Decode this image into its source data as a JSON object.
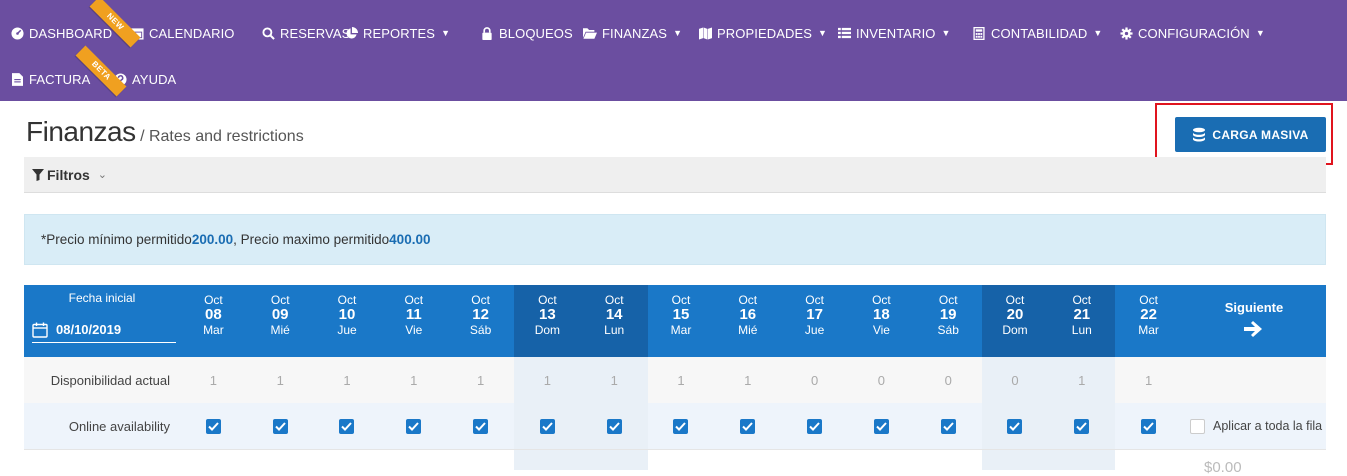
{
  "nav": {
    "row1": [
      {
        "key": "dashboard",
        "label": "DASHBOARD",
        "icon": "dashboard-icon",
        "caret": false
      },
      {
        "key": "calendario",
        "label": "CALENDARIO",
        "icon": "calendar-icon",
        "caret": false
      },
      {
        "key": "reservas",
        "label": "RESERVAS",
        "icon": "search-icon",
        "caret": false
      },
      {
        "key": "reportes",
        "label": "REPORTES",
        "icon": "pie-chart-icon",
        "caret": true
      },
      {
        "key": "bloqueos",
        "label": "BLOQUEOS",
        "icon": "lock-icon",
        "caret": false
      },
      {
        "key": "finanzas",
        "label": "FINANZAS",
        "icon": "folder-open-icon",
        "caret": true
      },
      {
        "key": "propiedades",
        "label": "PROPIEDADES",
        "icon": "map-icon",
        "caret": true
      },
      {
        "key": "inventario",
        "label": "INVENTARIO",
        "icon": "list-icon",
        "caret": true
      },
      {
        "key": "contabilidad",
        "label": "CONTABILIDAD",
        "icon": "calculator-icon",
        "caret": true
      },
      {
        "key": "configuracion",
        "label": "CONFIGURACIÓN",
        "icon": "gear-icon",
        "caret": true
      }
    ],
    "row2": [
      {
        "key": "factura",
        "label": "FACTURA",
        "icon": "file-icon",
        "caret": false
      },
      {
        "key": "ayuda",
        "label": "AYUDA",
        "icon": "question-icon",
        "caret": false
      }
    ],
    "ribbon_new": "NEW",
    "ribbon_beta": "BETA"
  },
  "page": {
    "title": "Finanzas",
    "subtitle": "/ Rates and restrictions",
    "carga_masiva": "CARGA MASIVA",
    "filters_label": "Filtros"
  },
  "alert": {
    "prefix": "*Precio mínimo permitido ",
    "min": "200.00",
    "middle": " , Precio maximo permitido ",
    "max": "400.00"
  },
  "grid": {
    "fecha_label": "Fecha inicial",
    "fecha_value": "08/10/2019",
    "siguiente_label": "Siguiente",
    "days": [
      {
        "month": "Oct",
        "day": "08",
        "weekday": "Mar",
        "weekend": false,
        "disp": "1"
      },
      {
        "month": "Oct",
        "day": "09",
        "weekday": "Mié",
        "weekend": false,
        "disp": "1"
      },
      {
        "month": "Oct",
        "day": "10",
        "weekday": "Jue",
        "weekend": false,
        "disp": "1"
      },
      {
        "month": "Oct",
        "day": "11",
        "weekday": "Vie",
        "weekend": false,
        "disp": "1"
      },
      {
        "month": "Oct",
        "day": "12",
        "weekday": "Sáb",
        "weekend": false,
        "disp": "1"
      },
      {
        "month": "Oct",
        "day": "13",
        "weekday": "Dom",
        "weekend": true,
        "disp": "1"
      },
      {
        "month": "Oct",
        "day": "14",
        "weekday": "Lun",
        "weekend": true,
        "disp": "1"
      },
      {
        "month": "Oct",
        "day": "15",
        "weekday": "Mar",
        "weekend": false,
        "disp": "1"
      },
      {
        "month": "Oct",
        "day": "16",
        "weekday": "Mié",
        "weekend": false,
        "disp": "1"
      },
      {
        "month": "Oct",
        "day": "17",
        "weekday": "Jue",
        "weekend": false,
        "disp": "0"
      },
      {
        "month": "Oct",
        "day": "18",
        "weekday": "Vie",
        "weekend": false,
        "disp": "0"
      },
      {
        "month": "Oct",
        "day": "19",
        "weekday": "Sáb",
        "weekend": false,
        "disp": "0"
      },
      {
        "month": "Oct",
        "day": "20",
        "weekday": "Dom",
        "weekend": true,
        "disp": "0"
      },
      {
        "month": "Oct",
        "day": "21",
        "weekday": "Lun",
        "weekend": true,
        "disp": "1"
      },
      {
        "month": "Oct",
        "day": "22",
        "weekday": "Mar",
        "weekend": false,
        "disp": "1"
      }
    ],
    "rows": {
      "disponibilidad_label": "Disponibilidad actual",
      "online_label": "Online availability",
      "online_checked": true,
      "apply_row_label": "Aplicar a toda la fila",
      "partial_price": "$0.00"
    }
  },
  "colors": {
    "nav_bg": "#6b4ea0",
    "header_blue": "#1a78c8",
    "weekend_blue": "#1662a8",
    "ribbon": "#f0a020",
    "highlight": "#e0141e"
  }
}
